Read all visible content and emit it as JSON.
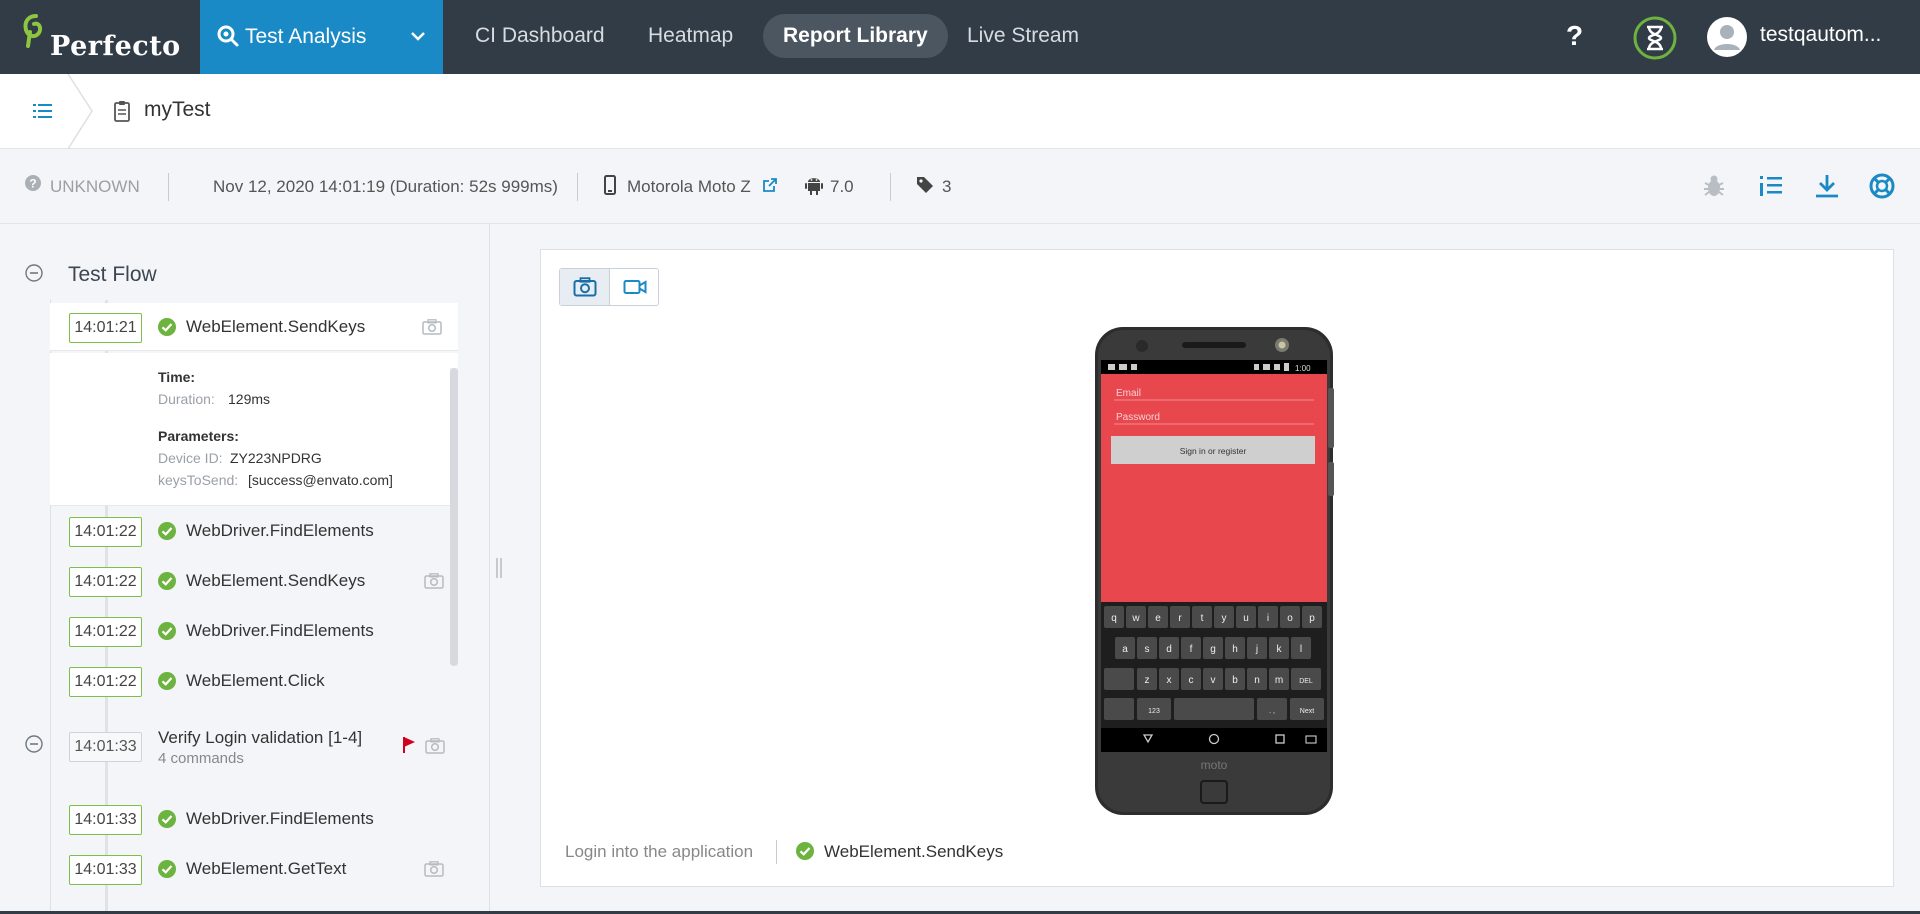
{
  "app": {
    "brand": "Perfecto",
    "product": "Test Analysis"
  },
  "nav": {
    "items": [
      {
        "label": "CI Dashboard",
        "active": false
      },
      {
        "label": "Heatmap",
        "active": false
      },
      {
        "label": "Report Library",
        "active": true
      },
      {
        "label": "Live Stream",
        "active": false
      }
    ],
    "help": "?",
    "username": "testqautom..."
  },
  "breadcrumb": {
    "title": "myTest"
  },
  "info": {
    "status": "UNKNOWN",
    "datetime": "Nov 12, 2020 14:01:19 (Duration: 52s 999ms)",
    "device": "Motorola Moto Z",
    "os_version": "7.0",
    "tags_count": "3"
  },
  "flow": {
    "title": "Test Flow",
    "expanded_command": {
      "time": "14:01:21",
      "name": "WebElement.SendKeys",
      "time_label": "Time:",
      "duration_label": "Duration:",
      "duration": "129ms",
      "parameters_label": "Parameters:",
      "device_id_label": "Device ID:",
      "device_id": "ZY223NPDRG",
      "keys_label": "keysToSend:",
      "keys": "[success@envato.com]"
    },
    "commands": [
      {
        "time": "14:01:22",
        "name": "WebDriver.FindElements"
      },
      {
        "time": "14:01:22",
        "name": "WebElement.SendKeys"
      },
      {
        "time": "14:01:22",
        "name": "WebDriver.FindElements"
      },
      {
        "time": "14:01:22",
        "name": "WebElement.Click"
      }
    ],
    "group": {
      "time": "14:01:33",
      "name": "Verify Login validation  [1-4]",
      "sub": "4 commands"
    },
    "group_commands": [
      {
        "time": "14:01:33",
        "name": "WebDriver.FindElements"
      },
      {
        "time": "14:01:33",
        "name": "WebElement.GetText"
      }
    ]
  },
  "viewer": {
    "caption_step": "Login into the application",
    "caption_command": "WebElement.SendKeys",
    "screen": {
      "email_placeholder": "Email",
      "password_placeholder": "Password",
      "signin_button": "Sign in or register",
      "clock": "1:00",
      "brand": "moto",
      "keyboard_row1": [
        "q",
        "w",
        "e",
        "r",
        "t",
        "y",
        "u",
        "i",
        "o",
        "p"
      ],
      "keyboard_row2": [
        "a",
        "s",
        "d",
        "f",
        "g",
        "h",
        "j",
        "k",
        "l"
      ],
      "keyboard_row3": [
        "z",
        "x",
        "c",
        "v",
        "b",
        "n",
        "m"
      ],
      "key_123": "123",
      "key_next": "Next",
      "key_del": "DEL",
      "key_punct": ". ,"
    }
  },
  "colors": {
    "topbar": "#323c46",
    "accent": "#1a8ac6",
    "success": "#6db33f",
    "app_red": "#e9474e",
    "flag": "#d0021b"
  }
}
